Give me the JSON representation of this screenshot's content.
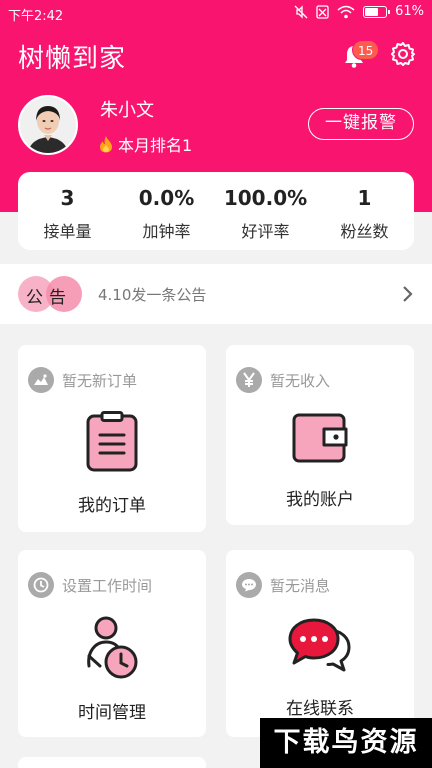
{
  "status_bar": {
    "time": "下午2:42",
    "battery": "61%"
  },
  "header": {
    "title": "树懒到家",
    "notification_count": "15",
    "alarm_button": "一键报警"
  },
  "profile": {
    "name": "朱小文",
    "rank": "本月排名1"
  },
  "stats": [
    {
      "value": "3",
      "label": "接单量"
    },
    {
      "value": "0.0%",
      "label": "加钟率"
    },
    {
      "value": "100.0%",
      "label": "好评率"
    },
    {
      "value": "1",
      "label": "粉丝数"
    }
  ],
  "notice": {
    "tag": "公告",
    "text": "4.10发一条公告"
  },
  "cards": [
    {
      "status": "暂无新订单",
      "label": "我的订单",
      "icon": "clipboard-icon"
    },
    {
      "status": "暂无收入",
      "label": "我的账户",
      "icon": "wallet-icon"
    },
    {
      "status": "设置工作时间",
      "label": "时间管理",
      "icon": "time-management-icon"
    },
    {
      "status": "暂无消息",
      "label": "在线联系",
      "icon": "chat-bubbles-icon"
    }
  ],
  "watermark": "下载鸟资源",
  "colors": {
    "brand": "#f8146f",
    "accent_soft": "#f7a5bd"
  }
}
